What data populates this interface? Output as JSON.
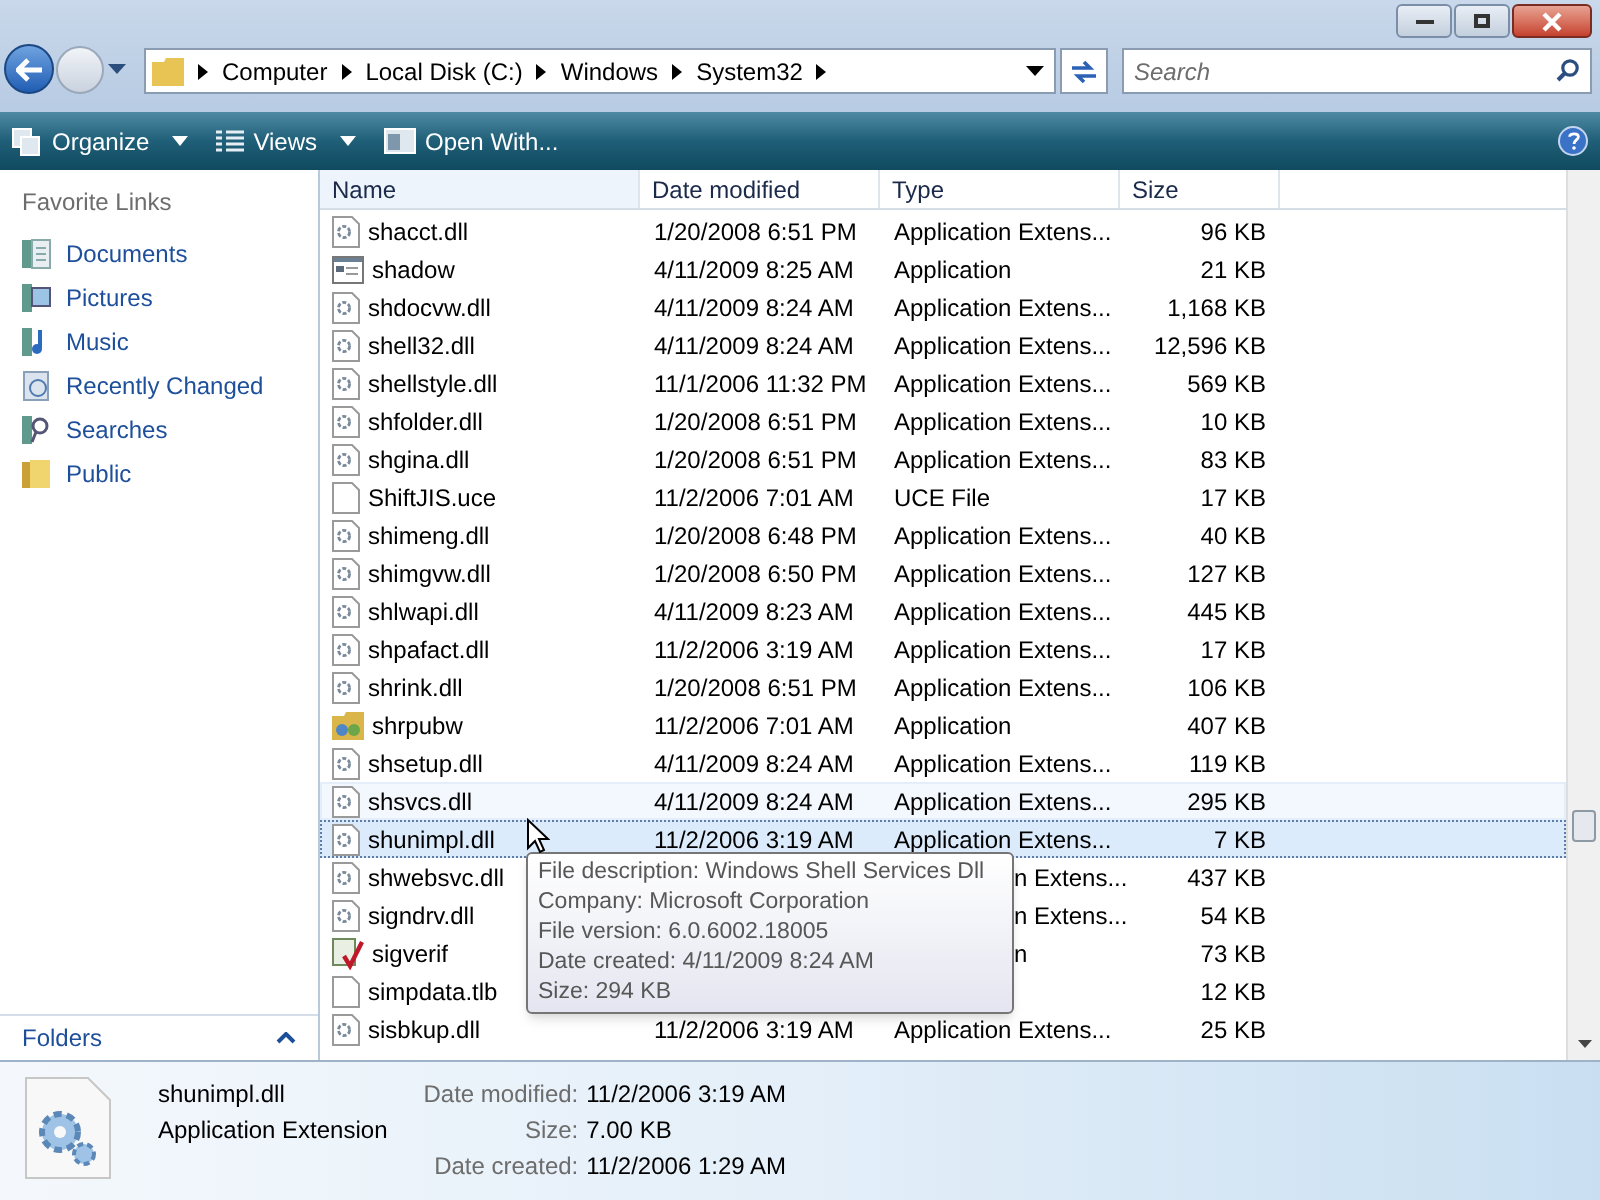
{
  "address_bar": {
    "crumbs": [
      "Computer",
      "Local Disk (C:)",
      "Windows",
      "System32"
    ]
  },
  "search": {
    "placeholder": "Search"
  },
  "toolbar": {
    "buttons": [
      {
        "label": "Organize",
        "kind": "organize"
      },
      {
        "label": "Views",
        "kind": "views"
      },
      {
        "label": "Open With...",
        "kind": "open"
      }
    ]
  },
  "sidebar": {
    "heading": "Favorite Links",
    "items": [
      {
        "label": "Documents",
        "kind": "documents"
      },
      {
        "label": "Pictures",
        "kind": "pictures"
      },
      {
        "label": "Music",
        "kind": "music"
      },
      {
        "label": "Recently Changed",
        "kind": "recent"
      },
      {
        "label": "Searches",
        "kind": "searches"
      },
      {
        "label": "Public",
        "kind": "folder"
      }
    ],
    "folders_label": "Folders"
  },
  "table": {
    "columns": [
      "Name",
      "Date modified",
      "Type",
      "Size"
    ],
    "rows": [
      {
        "name": "shacct.dll",
        "date": "1/20/2008 6:51 PM",
        "type": "Application Extens...",
        "size": "96 KB",
        "kind": "dll",
        "selected": false,
        "hovered": false
      },
      {
        "name": "shadow",
        "date": "4/11/2009 8:25 AM",
        "type": "Application",
        "size": "21 KB",
        "kind": "app",
        "selected": false,
        "hovered": false
      },
      {
        "name": "shdocvw.dll",
        "date": "4/11/2009 8:24 AM",
        "type": "Application Extens...",
        "size": "1,168 KB",
        "kind": "dll",
        "selected": false,
        "hovered": false
      },
      {
        "name": "shell32.dll",
        "date": "4/11/2009 8:24 AM",
        "type": "Application Extens...",
        "size": "12,596 KB",
        "kind": "dll",
        "selected": false,
        "hovered": false
      },
      {
        "name": "shellstyle.dll",
        "date": "11/1/2006 11:32 PM",
        "type": "Application Extens...",
        "size": "569 KB",
        "kind": "dll",
        "selected": false,
        "hovered": false
      },
      {
        "name": "shfolder.dll",
        "date": "1/20/2008 6:51 PM",
        "type": "Application Extens...",
        "size": "10 KB",
        "kind": "dll",
        "selected": false,
        "hovered": false
      },
      {
        "name": "shgina.dll",
        "date": "1/20/2008 6:51 PM",
        "type": "Application Extens...",
        "size": "83 KB",
        "kind": "dll",
        "selected": false,
        "hovered": false
      },
      {
        "name": "ShiftJIS.uce",
        "date": "11/2/2006 7:01 AM",
        "type": "UCE File",
        "size": "17 KB",
        "kind": "blank",
        "selected": false,
        "hovered": false
      },
      {
        "name": "shimeng.dll",
        "date": "1/20/2008 6:48 PM",
        "type": "Application Extens...",
        "size": "40 KB",
        "kind": "dll",
        "selected": false,
        "hovered": false
      },
      {
        "name": "shimgvw.dll",
        "date": "1/20/2008 6:50 PM",
        "type": "Application Extens...",
        "size": "127 KB",
        "kind": "dll",
        "selected": false,
        "hovered": false
      },
      {
        "name": "shlwapi.dll",
        "date": "4/11/2009 8:23 AM",
        "type": "Application Extens...",
        "size": "445 KB",
        "kind": "dll",
        "selected": false,
        "hovered": false
      },
      {
        "name": "shpafact.dll",
        "date": "11/2/2006 3:19 AM",
        "type": "Application Extens...",
        "size": "17 KB",
        "kind": "dll",
        "selected": false,
        "hovered": false
      },
      {
        "name": "shrink.dll",
        "date": "1/20/2008 6:51 PM",
        "type": "Application Extens...",
        "size": "106 KB",
        "kind": "dll",
        "selected": false,
        "hovered": false
      },
      {
        "name": "shrpubw",
        "date": "11/2/2006 7:01 AM",
        "type": "Application",
        "size": "407 KB",
        "kind": "wizard",
        "selected": false,
        "hovered": false
      },
      {
        "name": "shsetup.dll",
        "date": "4/11/2009 8:24 AM",
        "type": "Application Extens...",
        "size": "119 KB",
        "kind": "dll",
        "selected": false,
        "hovered": false
      },
      {
        "name": "shsvcs.dll",
        "date": "4/11/2009 8:24 AM",
        "type": "Application Extens...",
        "size": "295 KB",
        "kind": "dll",
        "selected": false,
        "hovered": true
      },
      {
        "name": "shunimpl.dll",
        "date": "11/2/2006 3:19 AM",
        "type": "Application Extens...",
        "size": "7 KB",
        "kind": "dll",
        "selected": true,
        "hovered": false
      },
      {
        "name": "shwebsvc.dll",
        "type_visible": "n Extens...",
        "size": "437 KB",
        "kind": "dll",
        "selected": false,
        "hovered": false
      },
      {
        "name": "signdrv.dll",
        "type_visible": "n Extens...",
        "size": "54 KB",
        "kind": "dll",
        "selected": false,
        "hovered": false
      },
      {
        "name": "sigverif",
        "type_visible": "n",
        "size": "73 KB",
        "kind": "check",
        "selected": false,
        "hovered": false
      },
      {
        "name": "simpdata.tlb",
        "size": "12 KB",
        "kind": "blank",
        "selected": false,
        "hovered": false
      },
      {
        "name": "sisbkup.dll",
        "date": "11/2/2006 3:19 AM",
        "type": "Application Extens...",
        "size": "25 KB",
        "kind": "dll",
        "selected": false,
        "hovered": false
      }
    ]
  },
  "tooltip": {
    "lines": [
      "File description: Windows Shell Services Dll",
      "Company: Microsoft Corporation",
      "File version: 6.0.6002.18005",
      "Date created: 4/11/2009 8:24 AM",
      "Size: 294 KB"
    ]
  },
  "details": {
    "name": "shunimpl.dll",
    "type": "Application Extension",
    "fields": [
      {
        "label": "Date modified:",
        "value": "11/2/2006 3:19 AM"
      },
      {
        "label": "Size:",
        "value": "7.00 KB"
      },
      {
        "label": "Date created:",
        "value": "11/2/2006 1:29 AM"
      }
    ]
  }
}
